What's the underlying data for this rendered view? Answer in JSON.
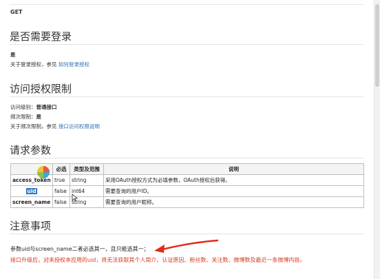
{
  "method": "GET",
  "login": {
    "title": "是否需要登录",
    "value": "是",
    "ref_prefix": "关于登录授权，参见",
    "ref_link": "如何登录授权"
  },
  "access": {
    "title": "访问授权限制",
    "level_label": "访问级别：",
    "level_value": "普通接口",
    "freq_label": "频次限制：",
    "freq_value": "是",
    "ref_prefix": "关于频次限制，参见",
    "ref_link": "接口访问权限说明"
  },
  "params": {
    "title": "请求参数",
    "headers": [
      "",
      "必选",
      "类型及范围",
      "说明"
    ],
    "rows": [
      {
        "name": "access_token",
        "required": "true",
        "type": "string",
        "desc": "采用OAuth授权方式为必填参数，OAuth授权后获得。"
      },
      {
        "name": "uid",
        "required": "false",
        "type": "int64",
        "desc": "需要查询的用户ID。"
      },
      {
        "name": "screen_name",
        "required": "false",
        "type": "string",
        "desc": "需要查询的用户昵称。"
      }
    ]
  },
  "notes": {
    "title": "注意事项",
    "line1": "参数uid与screen_name二者必选其一，且只能选其一；",
    "line2": "接口升级后，对未授权本应用的uid，将无法获取其个人简介、认证原因、粉丝数、关注数、微博数及最近一条微博内容。"
  },
  "colors": {
    "link": "#2f6fb3",
    "warning": "#d43b1f",
    "arrow": "#e02a14",
    "highlight": "#2f78c5"
  },
  "icons": {
    "logo": "colorful-pie-logo-icon",
    "cursor": "mouse-pointer-icon",
    "arrow": "red-annotation-arrow-icon"
  }
}
